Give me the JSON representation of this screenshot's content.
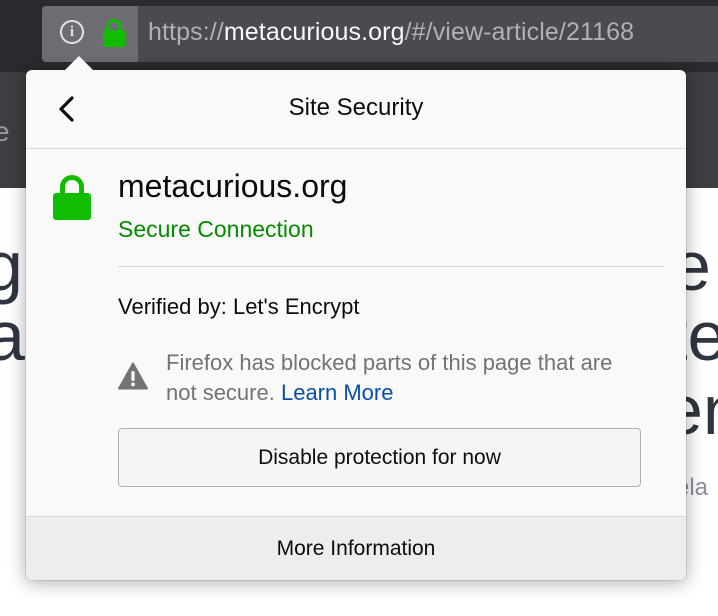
{
  "urlbar": {
    "scheme": "https://",
    "host": "metacurious.org",
    "path": "/#/view-article/21168",
    "info_icon": "info-icon",
    "lock_icon": "lock-icon",
    "lock_color": "#12bc00"
  },
  "background_page": {
    "tab_fragment": "e",
    "heading_lines": [
      {
        "left": "g",
        "right": "e c"
      },
      {
        "left": "a",
        "right": "te"
      },
      {
        "left": "",
        "right": "en"
      }
    ],
    "subtext_fragment": "sela"
  },
  "panel": {
    "back_icon": "chevron-left-icon",
    "title": "Site Security",
    "host": "metacurious.org",
    "connection_status": "Secure Connection",
    "connection_color": "#058b00",
    "verified_by": "Verified by: Let's Encrypt",
    "warning_icon": "warning-triangle-icon",
    "mixed_content_message": "Firefox has blocked parts of this page that are not secure.",
    "learn_more_label": "Learn More",
    "disable_button_label": "Disable protection for now",
    "more_info_label": "More Information"
  }
}
